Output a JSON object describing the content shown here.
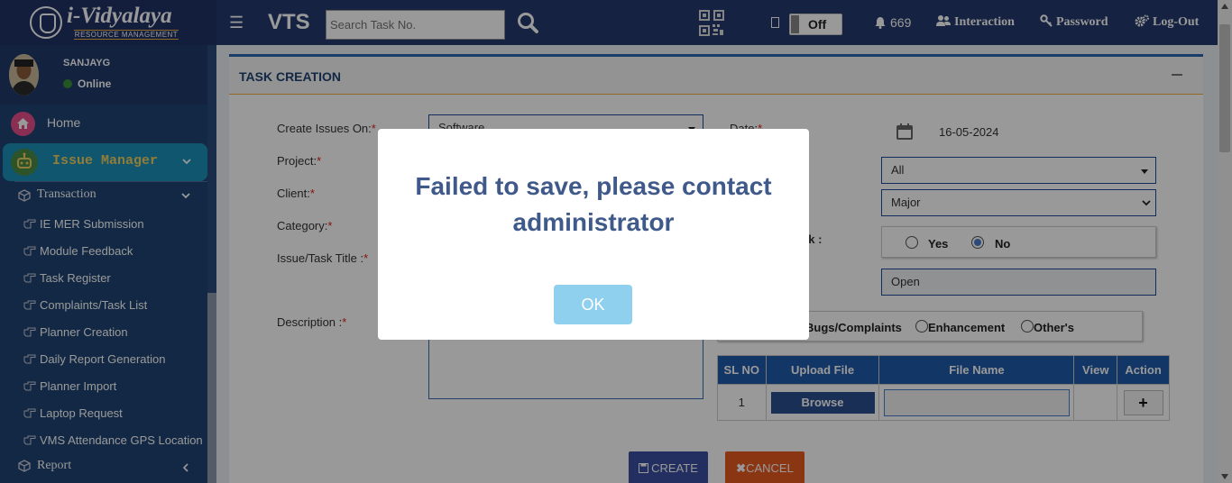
{
  "header": {
    "logo_title": "i-Vidyalaya",
    "logo_subtitle": "RESOURCE MANAGEMENT",
    "app_name": "VTS",
    "search_placeholder": "Search Task No.",
    "toggle_label": "Off",
    "notification_count": "669",
    "nav_interaction": "Interaction",
    "nav_password": "Password",
    "nav_logout": "Log-Out"
  },
  "sidebar": {
    "user_name": "SANJAYG",
    "user_status": "Online",
    "home": "Home",
    "issue_manager": "Issue Manager",
    "transaction": "Transaction",
    "items": [
      "IE MER Submission",
      "Module Feedback",
      "Task Register",
      "Complaints/Task List",
      "Planner Creation",
      "Daily Report Generation",
      "Planner Import",
      "Laptop Request",
      "VMS Attendance GPS Location"
    ],
    "report": "Report"
  },
  "panel": {
    "title": "TASK CREATION"
  },
  "form": {
    "create_issues_on_label": "Create Issues On:",
    "create_issues_on_value": "Software",
    "project_label": "Project:",
    "client_label": "Client:",
    "category_label": "Category:",
    "title_label": "Issue/Task Title :",
    "description_label": "Description :",
    "date_label": "Date:",
    "date_value": "16-05-2024",
    "select_all_value": "All",
    "priority_value": "Major",
    "task_label_fragment": "sk :",
    "yes_label": "Yes",
    "no_label": "No",
    "status_value": "Open",
    "type_bugs": "Bugs/Complaints",
    "type_enhancement": "Enhancement",
    "type_others": "Other's"
  },
  "file_table": {
    "headers": [
      "SL NO",
      "Upload File",
      "File Name",
      "View",
      "Action"
    ],
    "row_sl": "1",
    "browse_label": "Browse",
    "add_label": "+"
  },
  "buttons": {
    "create": "CREATE",
    "cancel": "CANCEL"
  },
  "modal": {
    "message": "Failed to save, please contact administrator",
    "ok": "OK"
  },
  "colors": {
    "header_bg": "#253a6d",
    "sidebar_bg": "#1f4472",
    "issue_manager_bg": "#1a8fb8",
    "accent_blue": "#1f5aa8",
    "create_btn": "#3a4fa0",
    "cancel_btn": "#e85a20",
    "modal_text": "#3f5a8a",
    "ok_btn": "#8fd0ee"
  }
}
